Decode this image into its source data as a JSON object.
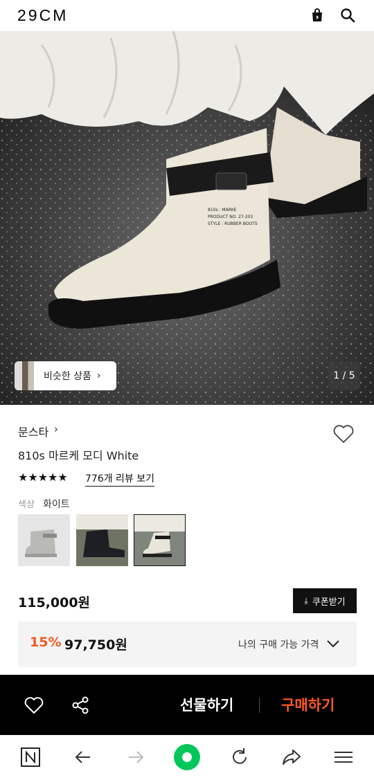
{
  "header": {
    "logo": "29CM",
    "bag_icon": "shopping-bag-icon",
    "search_icon": "search-icon"
  },
  "hero": {
    "similar_label": "비슷한 상품",
    "page_indicator": "1 / 5"
  },
  "product": {
    "brand": "문스타",
    "name": "810s 마르케 모디 White",
    "rating_stars": "★★★★★",
    "review_link": "776개 리뷰 보기",
    "color_label": "색상",
    "color_value": "화이트",
    "price": "115,000원",
    "coupon_label": "쿠폰받기",
    "discount_rate": "15%",
    "discount_price": "97,750원",
    "my_price_label": "나의 구매 가능 가격"
  },
  "buy_bar": {
    "gift_label": "선물하기",
    "buy_label": "구매하기"
  },
  "colors": {
    "accent": "#f05a1e",
    "buy": "#ff5a1f",
    "bar": "#000000"
  }
}
